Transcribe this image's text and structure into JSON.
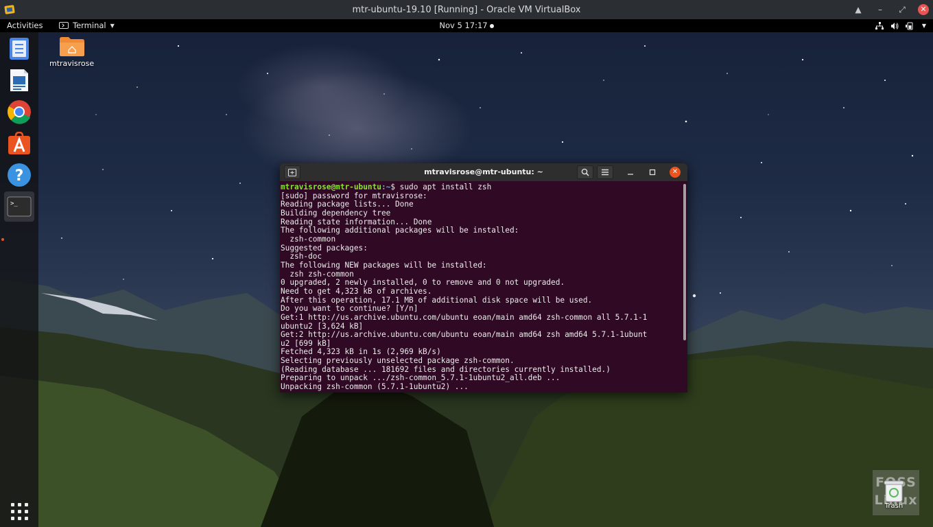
{
  "vbox": {
    "title": "mtr-ubuntu-19.10 [Running] - Oracle VM VirtualBox",
    "controls": [
      "restore-up-icon",
      "minimize-icon",
      "maximize-icon",
      "close-icon"
    ],
    "close_color": "#e95452"
  },
  "topbar": {
    "activities": "Activities",
    "app_menu_label": "Terminal",
    "clock": "Nov 5  17:17",
    "tray_icons": [
      "network-icon",
      "volume-icon",
      "battery-icon",
      "power-menu-icon"
    ]
  },
  "dock": {
    "items": [
      {
        "name": "files",
        "icon": "files-icon"
      },
      {
        "name": "libreoffice-writer",
        "icon": "writer-icon"
      },
      {
        "name": "chrome",
        "icon": "chrome-icon"
      },
      {
        "name": "software",
        "icon": "software-center-icon"
      },
      {
        "name": "help",
        "icon": "help-icon"
      },
      {
        "name": "terminal",
        "icon": "terminal-icon",
        "active": true
      }
    ],
    "show_apps_icon": "app-grid-icon",
    "running_indicator_color": "#e95420"
  },
  "desktop": {
    "home_folder_label": "mtravisrose",
    "trash_label": "Trash",
    "watermark_line1": "FOSS",
    "watermark_line2": "Linux"
  },
  "terminal": {
    "title": "mtravisrose@mtr-ubuntu: ~",
    "prompt_user": "mtravisrose@mtr-ubuntu",
    "prompt_path": ":~",
    "prompt_cmd": "$ sudo apt install zsh",
    "lines": [
      "[sudo] password for mtravisrose:",
      "Reading package lists... Done",
      "Building dependency tree",
      "Reading state information... Done",
      "The following additional packages will be installed:",
      "  zsh-common",
      "Suggested packages:",
      "  zsh-doc",
      "The following NEW packages will be installed:",
      "  zsh zsh-common",
      "0 upgraded, 2 newly installed, 0 to remove and 0 not upgraded.",
      "Need to get 4,323 kB of archives.",
      "After this operation, 17.1 MB of additional disk space will be used.",
      "Do you want to continue? [Y/n]",
      "Get:1 http://us.archive.ubuntu.com/ubuntu eoan/main amd64 zsh-common all 5.7.1-1",
      "ubuntu2 [3,624 kB]",
      "Get:2 http://us.archive.ubuntu.com/ubuntu eoan/main amd64 zsh amd64 5.7.1-1ubunt",
      "u2 [699 kB]",
      "Fetched 4,323 kB in 1s (2,969 kB/s)",
      "Selecting previously unselected package zsh-common.",
      "(Reading database ... 181692 files and directories currently installed.)",
      "Preparing to unpack .../zsh-common_5.7.1-1ubuntu2_all.deb ...",
      "Unpacking zsh-common (5.7.1-1ubuntu2) ..."
    ],
    "background": "#300a24",
    "close_color": "#e95420"
  }
}
